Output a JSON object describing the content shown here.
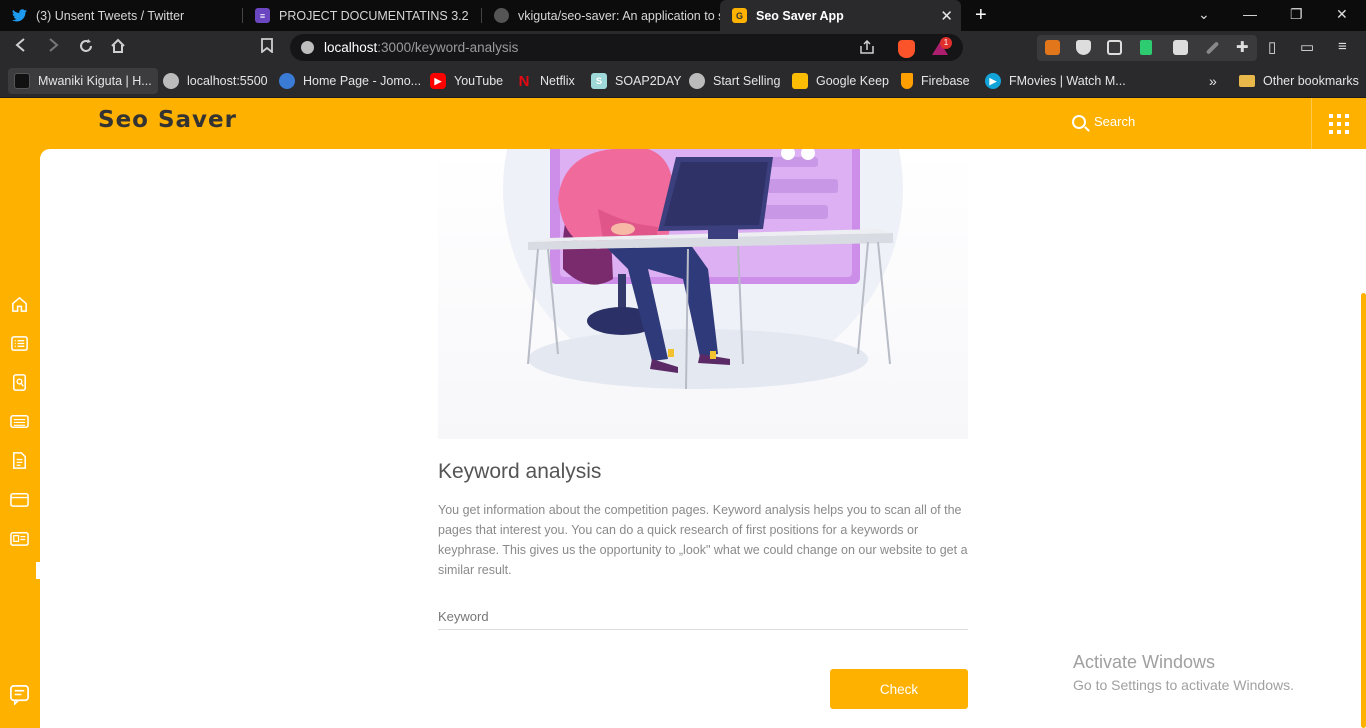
{
  "browser": {
    "tabs": [
      {
        "title": "(3) Unsent Tweets / Twitter",
        "color": "#1d9bf0"
      },
      {
        "title": "PROJECT DOCUMENTATINS 3.2",
        "color": "#6b46c1"
      },
      {
        "title": "vkiguta/seo-saver: An application to st",
        "color": "#333333"
      },
      {
        "title": "Seo Saver App",
        "color": "#ffb100"
      }
    ],
    "url_host": "localhost",
    "url_path": ":3000/keyword-analysis",
    "bookmarks": [
      {
        "label": "Mwaniki Kiguta | H..."
      },
      {
        "label": "localhost:5500"
      },
      {
        "label": "Home Page - Jomo..."
      },
      {
        "label": "YouTube"
      },
      {
        "label": "Netflix"
      },
      {
        "label": "SOAP2DAY"
      },
      {
        "label": "Start Selling"
      },
      {
        "label": "Google Keep"
      },
      {
        "label": "Firebase"
      },
      {
        "label": "FMovies | Watch M..."
      }
    ],
    "bookmarks_more": "»",
    "other_bookmarks": "Other bookmarks",
    "rewards_badge": "1"
  },
  "app": {
    "brand": "Seo Saver",
    "search_label": "Search",
    "accent": "#ffb100"
  },
  "main": {
    "title": "Keyword analysis",
    "description": "You get information about the competition pages. Keyword analysis helps you to scan all of the pages that interest you. You can do a quick research of first positions for a keywords or keyphrase. This gives us the opportunity to „look\" what we could change on our website to get a similar result.",
    "keyword_placeholder": "Keyword",
    "check_label": "Check"
  },
  "os_overlay": {
    "line1": "Activate Windows",
    "line2": "Go to Settings to activate Windows."
  }
}
